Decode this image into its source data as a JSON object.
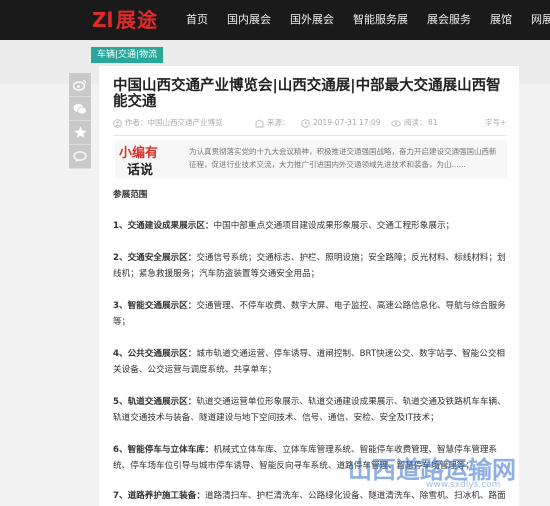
{
  "logo": {
    "mark": "Zl",
    "text": "展途"
  },
  "nav": [
    "首页",
    "国内展会",
    "国外展会",
    "智能服务展",
    "展会服务",
    "展馆",
    "网展"
  ],
  "category": "车辆|交通|物流",
  "share_icons": [
    "weibo-icon",
    "wechat-icon",
    "star-icon",
    "comment-icon"
  ],
  "article": {
    "title": "中国山西交通产业博览会|山西交通展|中部最大交通展山西智能交通",
    "author": "作者：中国山西交通产业博览",
    "source": "来源：",
    "date": "2019-07-31 17:09",
    "views_label": "阅读：",
    "views": "81",
    "font_size": "字号+"
  },
  "intro": {
    "badge_top": "小编有",
    "badge_bottom": "话说",
    "text": "为认真贯彻落实党的十九大会议精神，积极推进交通强国战略，奋力开启建设交通强国山西新征程，促进行业技术交流，大力推广引进国内外交通领域先进技术和装备，为山......"
  },
  "content": {
    "section_title": "参展范围",
    "items": [
      {
        "head": "1、交通建设成果展示区：",
        "text": "中国中部重点交通项目建设成果形象展示、交通工程形象展示；"
      },
      {
        "head": "2、交通安全展示区：",
        "text": "交通信号系统；交通标志、护栏、照明设施；安全路障；反光材料、标线材料；划线机；紧急救援服务；汽车防盗装置等交通安全用品；"
      },
      {
        "head": "3、智能交通展示区：",
        "text": "交通管理、不停车收费、数字大屏、电子监控、高速公路信息化、导航与综合服务等；"
      },
      {
        "head": "4、公共交通展示区：",
        "text": "城市轨道交通运营、停车诱导、道闸控制、BRT快速公交、数字站亭、智能公交相关设备、公交运营与调度系统、共享单车；"
      },
      {
        "head": "5、轨道交通展示区：",
        "text": "轨道交通运营单位形象展示、轨道交通建设成果展示、轨道交通及铁路机车车辆、轨道交通技术与装备、隧道建设与地下空间技术、信号、通信、安检、安全及IT技术；"
      },
      {
        "head": "6、智能停车与立体车库：",
        "text": "机械式立体车库、立体车库管理系统、智能停车收费管理、智慧停车管理系统、停车场车位引导与城市停车诱导、智能反向寻车系统、道路停车管理、智慧停车场管理等；"
      },
      {
        "head": "7、道路养护施工装备：",
        "text": "道路清扫车、护栏清洗车、公路绿化设备、隧道清洗车、除雪机、扫冰机、路面养护特种车辆等；除雪车、除冰车；"
      }
    ]
  },
  "watermark": {
    "text": "山西道路运输网",
    "url": "www.sxdlys.com"
  }
}
